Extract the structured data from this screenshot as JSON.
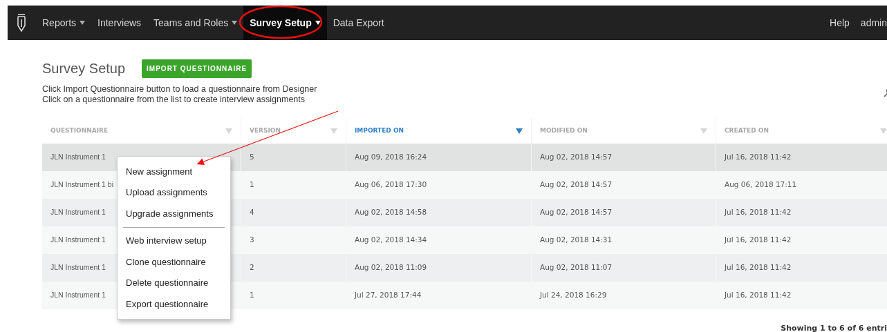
{
  "nav": {
    "items": [
      {
        "label": "Reports",
        "dropdown": true,
        "selected": false
      },
      {
        "label": "Interviews",
        "dropdown": false,
        "selected": false
      },
      {
        "label": "Teams and Roles",
        "dropdown": true,
        "selected": false
      },
      {
        "label": "Survey Setup",
        "dropdown": true,
        "selected": true
      },
      {
        "label": "Data Export",
        "dropdown": false,
        "selected": false
      }
    ],
    "right_items": [
      "Help",
      "admin"
    ]
  },
  "page": {
    "title": "Survey Setup",
    "import_button": "IMPORT QUESTIONNAIRE",
    "instructions": [
      "Click Import Questionnaire button to load a questionnaire from Designer",
      "Click on a questionnaire from the list to create interview assignments"
    ]
  },
  "table": {
    "columns": [
      {
        "label": "QUESTIONNAIRE",
        "sorted": false
      },
      {
        "label": "VERSION",
        "sorted": false
      },
      {
        "label": "IMPORTED ON",
        "sorted": true
      },
      {
        "label": "MODIFIED ON",
        "sorted": false
      },
      {
        "label": "CREATED ON",
        "sorted": false
      }
    ],
    "rows": [
      {
        "cells": [
          "JLN Instrument 1",
          "5",
          "Aug 09, 2018 16:24",
          "Aug 02, 2018 14:57",
          "Jul 16, 2018 11:42"
        ],
        "selected": true
      },
      {
        "cells": [
          "JLN Instrument 1 bi",
          "1",
          "Aug 06, 2018 17:30",
          "Aug 02, 2018 14:57",
          "Aug 06, 2018 17:11"
        ],
        "selected": false
      },
      {
        "cells": [
          "JLN Instrument 1",
          "4",
          "Aug 02, 2018 14:58",
          "Aug 02, 2018 14:57",
          "Jul 16, 2018 11:42"
        ],
        "selected": false
      },
      {
        "cells": [
          "JLN Instrument 1",
          "3",
          "Aug 02, 2018 14:34",
          "Aug 02, 2018 14:31",
          "Jul 16, 2018 11:42"
        ],
        "selected": false
      },
      {
        "cells": [
          "JLN Instrument 1",
          "2",
          "Aug 02, 2018 11:09",
          "Aug 02, 2018 11:07",
          "Jul 16, 2018 11:42"
        ],
        "selected": false
      },
      {
        "cells": [
          "JLN Instrument 1",
          "1",
          "Jul 27, 2018 17:44",
          "Jul 24, 2018 16:29",
          "Jul 16, 2018 11:42"
        ],
        "selected": false
      }
    ],
    "footer": "Showing 1 to 6 of 6 entri"
  },
  "context_menu": {
    "items": [
      {
        "label": "New assignment",
        "kind": "item"
      },
      {
        "label": "Upload assignments",
        "kind": "item"
      },
      {
        "label": "Upgrade assignments",
        "kind": "item"
      },
      {
        "kind": "divider"
      },
      {
        "label": "Web interview setup",
        "kind": "item"
      },
      {
        "label": "Clone questionnaire",
        "kind": "item"
      },
      {
        "label": "Delete questionnaire",
        "kind": "item"
      },
      {
        "label": "Export questionnaire",
        "kind": "item"
      }
    ]
  }
}
